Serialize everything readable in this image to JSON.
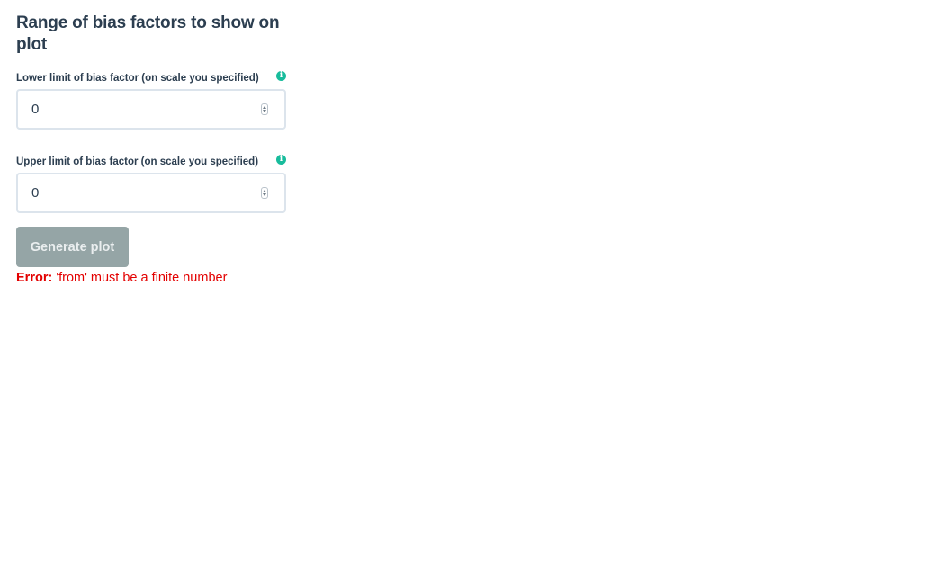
{
  "section": {
    "title": "Range of bias factors to show on plot"
  },
  "lower_limit": {
    "label": "Lower limit of bias factor (on scale you specified)",
    "value": "0",
    "info_icon": "info-circle-icon"
  },
  "upper_limit": {
    "label": "Upper limit of bias factor (on scale you specified)",
    "value": "0",
    "info_icon": "info-circle-icon"
  },
  "generate_button": {
    "label": "Generate plot"
  },
  "error": {
    "prefix": "Error:",
    "message": " 'from' must be a finite number"
  },
  "colors": {
    "accent": "#18bc9c",
    "button": "#95a5a6",
    "error": "#e30000",
    "text": "#2c3e50"
  }
}
